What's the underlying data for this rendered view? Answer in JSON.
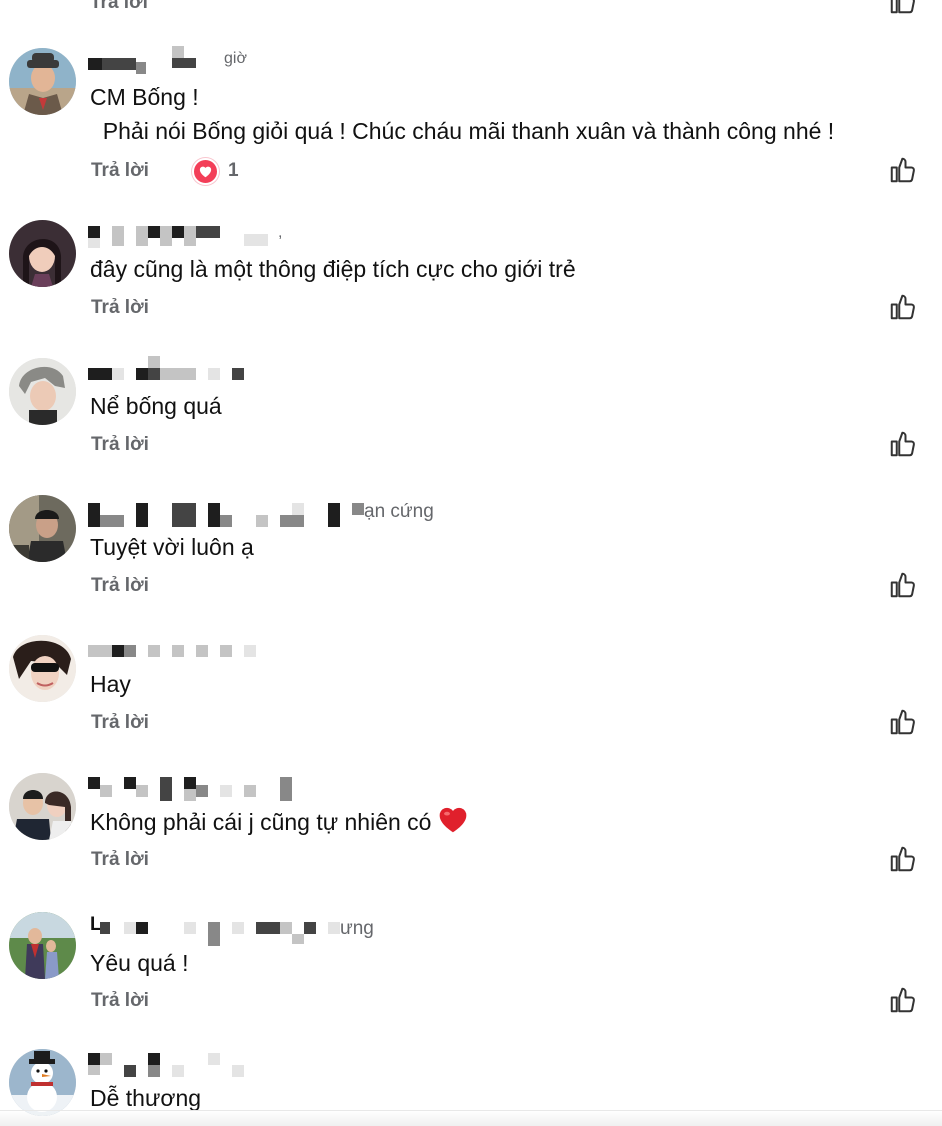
{
  "reply_label": "Trả lời",
  "colors": {
    "text": "#111111",
    "secondary": "#65676b",
    "reaction_heart": "#f33e58",
    "emoji_heart": "#e0202c"
  },
  "comments": [
    {
      "meta_suffix": "giờ",
      "lines": [
        "CM Bống !",
        "  Phải nói Bống giỏi quá ! Chúc cháu mãi thanh xuân và thành công nhé !"
      ],
      "reaction": {
        "icon": "heart-reaction-icon",
        "count": "1"
      }
    },
    {
      "meta_suffix": ",",
      "lines": [
        "đây cũng là một thông điệp tích cực cho giới trẻ"
      ]
    },
    {
      "lines": [
        "Nể bống quá"
      ]
    },
    {
      "meta_suffix": "ạn cứng",
      "lines": [
        "Tuyệt vời luôn ạ"
      ]
    },
    {
      "lines": [
        "Hay"
      ]
    },
    {
      "lines": [
        "Không phải cái j cũng tự nhiên có"
      ],
      "emoji": "red-heart-emoji"
    },
    {
      "name_initial": "L",
      "meta_suffix": "ưng",
      "lines": [
        "Yêu quá !"
      ]
    },
    {
      "lines": [
        "Dễ thương"
      ]
    }
  ]
}
